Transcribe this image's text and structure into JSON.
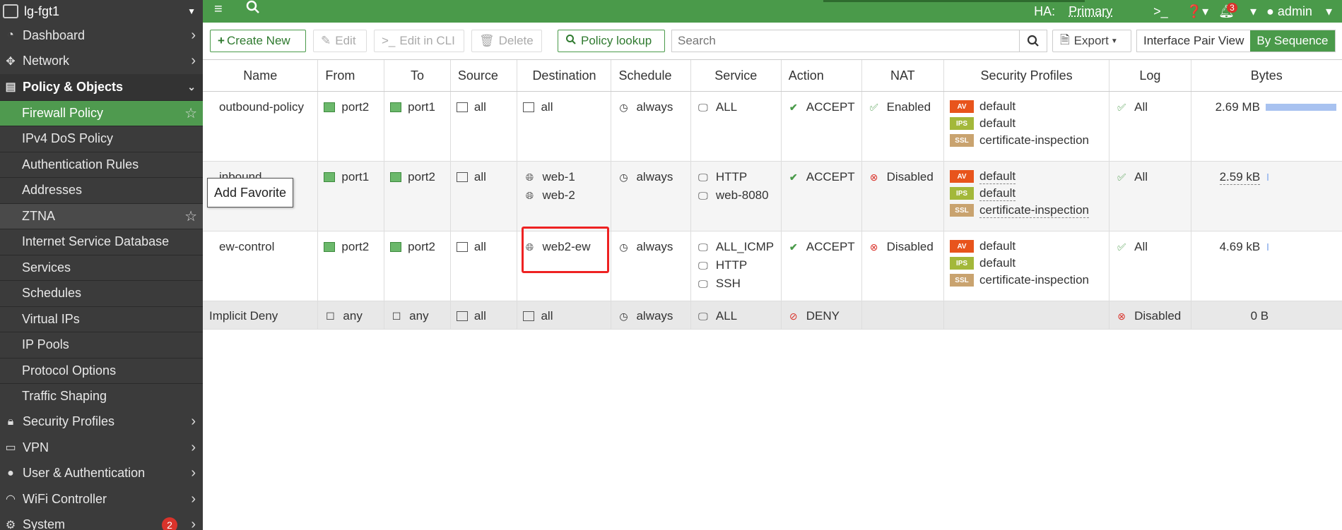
{
  "device": {
    "name": "lg-fgt1"
  },
  "sidebar": {
    "top_items": [
      {
        "label": "Dashboard",
        "icon": "dashboard-icon"
      },
      {
        "label": "Network",
        "icon": "network-icon"
      }
    ],
    "group": {
      "label": "Policy & Objects"
    },
    "sub_items": [
      "Firewall Policy",
      "IPv4 DoS Policy",
      "Authentication Rules",
      "Addresses",
      "ZTNA",
      "Internet Service Database",
      "Services",
      "Schedules",
      "Virtual IPs",
      "IP Pools",
      "Protocol Options",
      "Traffic Shaping"
    ],
    "bottom_items": [
      {
        "label": "Security Profiles",
        "icon": "lock-icon"
      },
      {
        "label": "VPN",
        "icon": "laptop-icon"
      },
      {
        "label": "User & Authentication",
        "icon": "user-icon"
      },
      {
        "label": "WiFi Controller",
        "icon": "wifi-icon"
      },
      {
        "label": "System",
        "icon": "gear-icon",
        "badge": "2"
      }
    ]
  },
  "topbar": {
    "ha_label": "HA:",
    "ha_value": "Primary",
    "notification_count": "3",
    "user": "admin"
  },
  "toolbar": {
    "create_new": "Create New",
    "edit": "Edit",
    "edit_cli": "Edit in CLI",
    "delete": "Delete",
    "policy_lookup": "Policy lookup",
    "search_placeholder": "Search",
    "export": "Export",
    "view_interface_pair": "Interface Pair View",
    "view_sequence": "By Sequence"
  },
  "table": {
    "headers": [
      "Name",
      "From",
      "To",
      "Source",
      "Destination",
      "Schedule",
      "Service",
      "Action",
      "NAT",
      "Security Profiles",
      "Log",
      "Bytes"
    ],
    "rows": [
      {
        "name": "outbound-policy",
        "from": "port2",
        "to": "port1",
        "source": "all",
        "destination": [
          "all"
        ],
        "schedule": "always",
        "service": [
          "ALL"
        ],
        "action": "ACCEPT",
        "nat": "Enabled",
        "profiles": [
          "default",
          "default",
          "certificate-inspection"
        ],
        "log": "All",
        "bytes": "2.69 MB",
        "bytes_fraction": 1.0
      },
      {
        "name": "inbound",
        "from": "port1",
        "to": "port2",
        "source": "all",
        "destination": [
          "web-1",
          "web-2"
        ],
        "schedule": "always",
        "service": [
          "HTTP",
          "web-8080"
        ],
        "action": "ACCEPT",
        "nat": "Disabled",
        "profiles": [
          "default",
          "default",
          "certificate-inspection"
        ],
        "log": "All",
        "bytes": "2.59 kB",
        "bytes_fraction": 0.01
      },
      {
        "name": "ew-control",
        "from": "port2",
        "to": "port2",
        "source": "all",
        "destination": [
          "web2-ew"
        ],
        "schedule": "always",
        "service": [
          "ALL_ICMP",
          "HTTP",
          "SSH"
        ],
        "action": "ACCEPT",
        "nat": "Disabled",
        "profiles": [
          "default",
          "default",
          "certificate-inspection"
        ],
        "log": "All",
        "bytes": "4.69 kB",
        "bytes_fraction": 0.01
      },
      {
        "name": "Implicit Deny",
        "from": "any",
        "to": "any",
        "source": "all",
        "destination": [
          "all"
        ],
        "schedule": "always",
        "service": [
          "ALL"
        ],
        "action": "DENY",
        "nat": "",
        "log": "Disabled",
        "bytes": "0 B"
      }
    ],
    "profile_tags": [
      "AV",
      "IPS",
      "SSL"
    ]
  },
  "tooltip": {
    "text": "Add Favorite"
  },
  "colors": {
    "brand_green": "#4a9a4a",
    "sidebar_bg": "#3b3b3b",
    "highlight_red": "#e22222"
  }
}
